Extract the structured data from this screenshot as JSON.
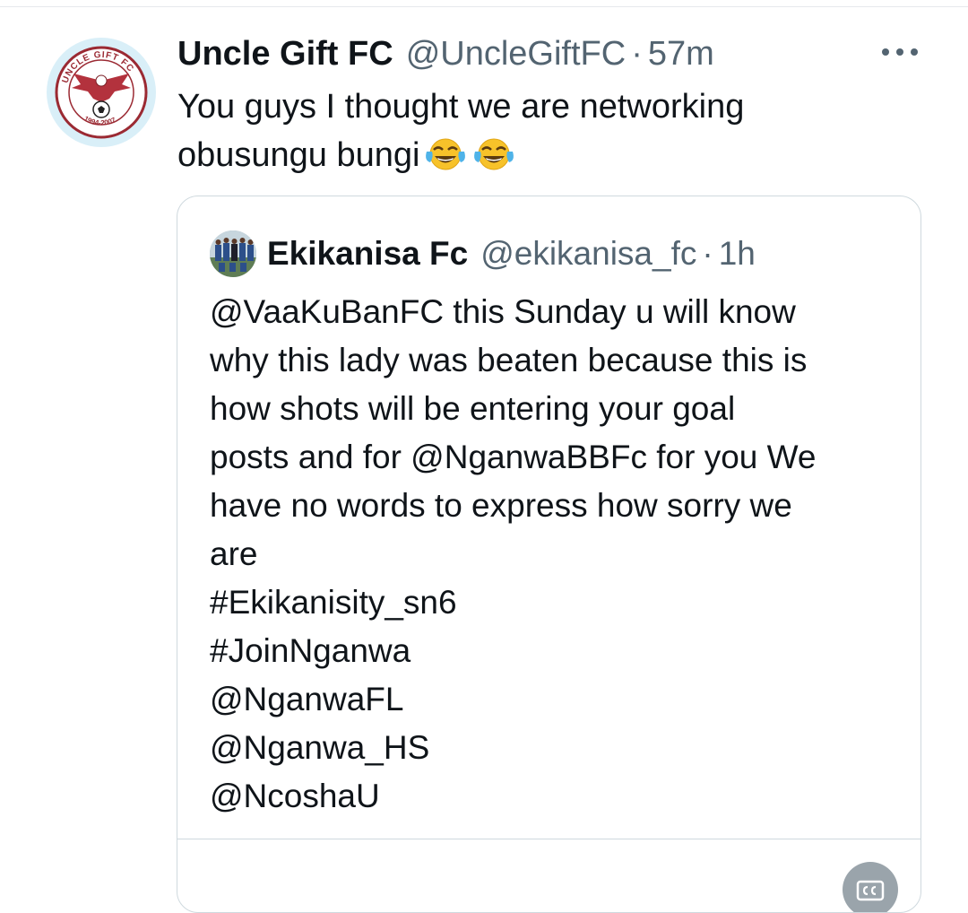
{
  "tweet": {
    "display_name": "Uncle Gift FC",
    "handle": "@UncleGiftFC",
    "separator": "·",
    "time": "57m",
    "text_line1": "You guys I thought we are networking",
    "text_line2": "obusungu bungi",
    "emojis": [
      "face-with-tears-of-joy-icon",
      "face-with-tears-of-joy-icon"
    ],
    "avatar": {
      "arc_text_top": "UNCLE GIFT FC",
      "arc_text_bottom": "1994-2007"
    }
  },
  "quote": {
    "display_name": "Ekikanisa Fc",
    "handle": "@ekikanisa_fc",
    "separator": "·",
    "time": "1h",
    "lines": [
      "@VaaKuBanFC this Sunday u will know",
      "why this lady was beaten because this is",
      "how shots will be entering your goal",
      "posts and for @NganwaBBFc for you We",
      "have no words to express how sorry we",
      "are",
      "#Ekikanisity_sn6",
      "#JoinNganwa",
      "@NganwaFL",
      "@Nganwa_HS",
      "@NcoshaU"
    ]
  },
  "colors": {
    "text_primary": "#0f1419",
    "text_secondary": "#536471",
    "border": "#cfd9de",
    "emoji_yellow": "#f7c22a"
  }
}
